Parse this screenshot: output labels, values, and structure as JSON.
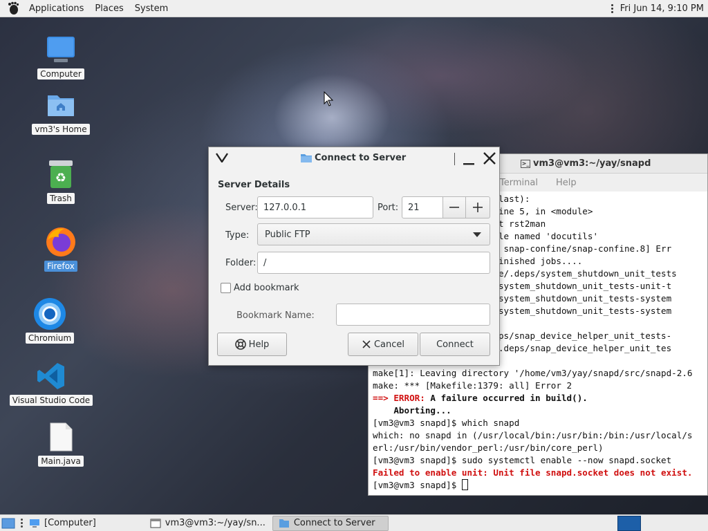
{
  "top_panel": {
    "menus": [
      "Applications",
      "Places",
      "System"
    ],
    "clock": "Fri Jun 14,  9:10 PM"
  },
  "desktop_icons": [
    {
      "label": "Computer",
      "icon": "computer-icon"
    },
    {
      "label": "vm3's Home",
      "icon": "home-folder-icon"
    },
    {
      "label": "Trash",
      "icon": "trash-icon"
    },
    {
      "label": "Firefox",
      "icon": "firefox-icon",
      "selected": true
    },
    {
      "label": "Chromium",
      "icon": "chromium-icon"
    },
    {
      "label": "Visual Studio Code",
      "icon": "vscode-icon"
    },
    {
      "label": "Main.java",
      "icon": "file-icon"
    }
  ],
  "terminal": {
    "title": "vm3@vm3:~/yay/snapd",
    "menus": [
      "Terminal",
      "Help"
    ],
    "lines": [
      {
        "text": "                   call last):"
      },
      {
        "text": "                   n\", line 5, in <module>"
      },
      {
        "text": "                   import rst2man"
      },
      {
        "text": "                    module named 'docutils'"
      },
      {
        "text": "                   4666: snap-confine/snap-confine.8] Err"
      },
      {
        "text": "                   r unfinished jobs...."
      },
      {
        "text": "                   rivate/.deps/system_shutdown_unit_tests"
      },
      {
        "text": "                   deps/system_shutdown_unit_tests-unit-t"
      },
      {
        "text": "                   deps/system_shutdown_unit_tests-system"
      },
      {
        "text": "                   deps/system_shutdown_unit_tests-system"
      },
      {
        "text": ""
      },
      {
        "text": "                   r/.deps/snap_device_helper_unit_tests-"
      },
      {
        "text": "                   lper/.deps/snap_device_helper_unit_tes"
      },
      {
        "text": ""
      },
      {
        "text": "make[1]: Leaving directory '/home/vm3/yay/snapd/src/snapd-2.6"
      },
      {
        "text": "make: *** [Makefile:1379: all] Error 2"
      },
      {
        "prefix": "==> ERROR:",
        "text": " A failure occurred in build().",
        "style": "error"
      },
      {
        "text": "    Aborting...",
        "style": "bold"
      },
      {
        "text": "[vm3@vm3 snapd]$ which snapd"
      },
      {
        "text": "which: no snapd in (/usr/local/bin:/usr/bin:/bin:/usr/local/s"
      },
      {
        "text": "erl:/usr/bin/vendor_perl:/usr/bin/core_perl)"
      },
      {
        "text": "[vm3@vm3 snapd]$ sudo systemctl enable --now snapd.socket"
      },
      {
        "text": "Failed to enable unit: Unit file snapd.socket does not exist.",
        "style": "red"
      },
      {
        "text": "[vm3@vm3 snapd]$ ",
        "cursor": true
      }
    ]
  },
  "dialog": {
    "title": "Connect to Server",
    "section": "Server Details",
    "server_label": "Server:",
    "server_value": "127.0.0.1",
    "port_label": "Port:",
    "port_value": "21",
    "type_label": "Type:",
    "type_value": "Public FTP",
    "folder_label": "Folder:",
    "folder_value": "/",
    "add_bookmark": "Add bookmark",
    "bookmark_name_label": "Bookmark Name:",
    "bookmark_name_value": "",
    "help": "Help",
    "cancel": "Cancel",
    "connect": "Connect"
  },
  "taskbar": {
    "tasks": [
      {
        "label": "[Computer]"
      },
      {
        "label": "vm3@vm3:~/yay/sn..."
      },
      {
        "label": "Connect to Server",
        "active": true
      }
    ]
  }
}
